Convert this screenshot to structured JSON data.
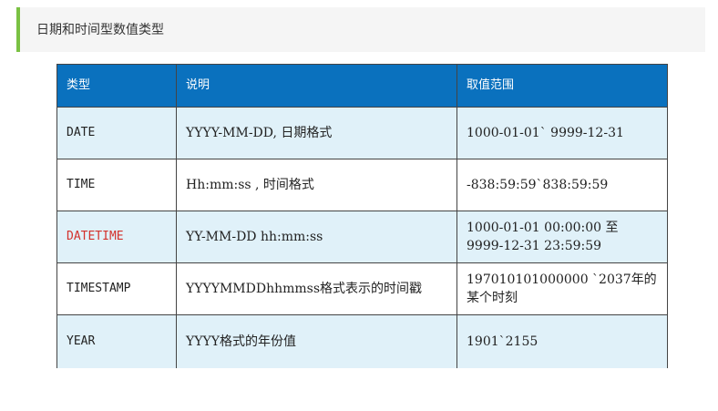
{
  "section": {
    "title": "日期和时间型数值类型"
  },
  "table": {
    "headers": [
      "类型",
      "说明",
      "取值范围"
    ],
    "rows": [
      {
        "type": "DATE",
        "description": "YYYY-MM-DD, 日期格式",
        "range": "1000-01-01` 9999-12-31"
      },
      {
        "type": "TIME",
        "description": "Hh:mm:ss , 时间格式",
        "range": "-838:59:59`838:59:59"
      },
      {
        "type": "DATETIME",
        "description": "YY-MM-DD hh:mm:ss",
        "range": "1000-01-01 00:00:00 至 9999-12-31 23:59:59"
      },
      {
        "type": "TIMESTAMP",
        "description": "YYYYMMDDhhmmss格式表示的时间戳",
        "range": "197010101000000 `2037年的某个时刻"
      },
      {
        "type": "YEAR",
        "description": "YYYY格式的年份值",
        "range": "1901`2155"
      }
    ]
  },
  "colors": {
    "header_bg": "#0a71be",
    "odd_row_bg": "#e0f1f9",
    "highlight_text": "#d3312c",
    "accent_bar": "#7ac143"
  }
}
